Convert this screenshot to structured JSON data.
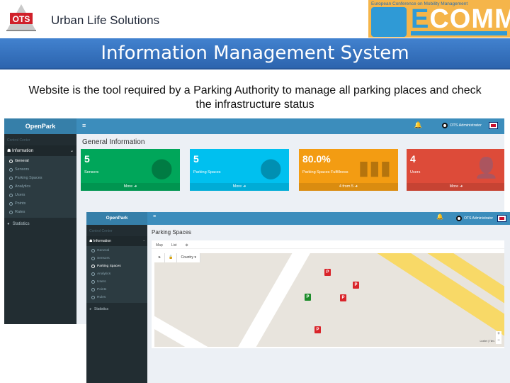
{
  "header": {
    "brand": "Urban Life Solutions",
    "logo_text": "OTS",
    "ecomm_tagline": "European Conference on Mobility Management",
    "ecomm_e": "E",
    "ecomm_rest": "COMM"
  },
  "title": "Information Management System",
  "description": "Website is the tool required by a Parking Authority to manage all parking places and check the infrastructure status",
  "screen1": {
    "app_name": "OpenPark",
    "menu_icon": "≡",
    "section_label": "Control Center",
    "group_label": "Information",
    "group_chevron": "⌄",
    "items": [
      {
        "label": "General",
        "active": true
      },
      {
        "label": "Sensors",
        "active": false
      },
      {
        "label": "Parking Spaces",
        "active": false
      },
      {
        "label": "Analytics",
        "active": false
      },
      {
        "label": "Users",
        "active": false
      },
      {
        "label": "Points",
        "active": false
      },
      {
        "label": "Rates",
        "active": false
      }
    ],
    "statistics": "Statistics",
    "user": "OTS Administrator",
    "page_title": "General Information",
    "boxes": [
      {
        "value": "5",
        "label": "Sensors",
        "footer": "More ➜",
        "color": "#00a65a",
        "icon": "map-marker"
      },
      {
        "value": "5",
        "label": "Parking Spaces",
        "footer": "More ➜",
        "color": "#00c0ef",
        "icon": "map-marker"
      },
      {
        "value": "80.0%",
        "label": "Parking Spaces Fulfillness",
        "footer": "4 from 5 ➜",
        "color": "#f39c12",
        "icon": "bar-chart"
      },
      {
        "value": "4",
        "label": "Users",
        "footer": "More ➜",
        "color": "#dd4b39",
        "icon": "user"
      }
    ]
  },
  "screen2": {
    "app_name": "OpenPark",
    "menu_icon": "≡",
    "section_label": "Control Center",
    "group_label": "Information",
    "group_chevron": "-",
    "items": [
      {
        "label": "General",
        "active": false
      },
      {
        "label": "Sensors",
        "active": false
      },
      {
        "label": "Parking Spaces",
        "active": true
      },
      {
        "label": "Analytics",
        "active": false
      },
      {
        "label": "Users",
        "active": false
      },
      {
        "label": "Points",
        "active": false
      },
      {
        "label": "Rules",
        "active": false
      }
    ],
    "statistics": "Statistics",
    "user": "OTS Administrator",
    "page_title": "Parking Spaces",
    "tabs": [
      "Map",
      "List",
      "⊕"
    ],
    "map_controls": {
      "locate": "➤",
      "lock": "🔓",
      "select": "Country ▾"
    },
    "pin_label": "P",
    "zoom_in": "+",
    "zoom_out": "−",
    "attribution": "Leaflet | Tiles"
  }
}
